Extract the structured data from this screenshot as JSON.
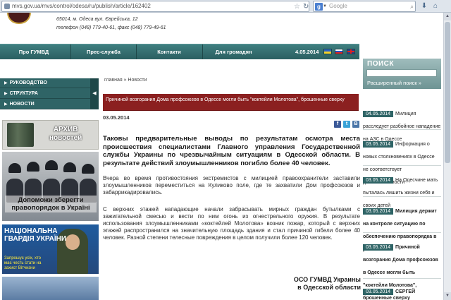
{
  "browser": {
    "url": "mvs.gov.ua/mvs/control/odesa/ru/publish/article/162402",
    "search_placeholder": "Google"
  },
  "header": {
    "address_line1": "65014, м. Одеса вул. Єврейська, 12",
    "address_line2": "телефон (048) 779-40-61, факс (048) 779-49-61"
  },
  "topnav": {
    "items": [
      "Про ГУМВД",
      "Прес-служба",
      "Контакти",
      "Для громадян"
    ],
    "date": "4.05.2014"
  },
  "sidebar": {
    "menu": [
      "РУКОВОДСТВО",
      "СТРУКТУРА",
      "НОВОСТИ"
    ],
    "archive_title_line1": "АРХИВ",
    "archive_title_line2": "новостей",
    "banner1_line1": "Допоможи зберегти",
    "banner1_line2": "правопорядок в Україні",
    "banner2_line1": "НАЦІОНАЛЬНА",
    "banner2_line2": "ГВАРДІЯ УКРАЇНИ",
    "banner2_sub_line1": "Запрошує усіх, хто",
    "banner2_sub_line2": "має честь стати на",
    "banner2_sub_line3": "захист Вітчизни"
  },
  "article": {
    "breadcrumb": "главная » Новости",
    "headline_banner": "Причиной возгорания Дома профсоюзов в Одессе могли быть \"коктейли Молотова\", брошенные сверху",
    "date": "03.05.2014",
    "share_icons": [
      "facebook-icon",
      "twitter-icon",
      "vkontakte-icon"
    ],
    "lead": "Таковы предварительные выводы по результатам осмотра места происшествия специалистами Главного управления Государственной службы Украины по чрезвычайным ситуациям в Одесской области. В результате действий злоумышленников погибло более 40 человек.",
    "paragraph1": "Вчера во время противостояния экстремистов с милицией правоохранители заставили злоумышленников переместиться на Куликово поле, где те захватили Дом профсоюзов и забаррикадировались.",
    "paragraph2": "С верхних этажей нападающие начали забрасывать мирных граждан бутылками с зажигательной смесью и вести по ним огонь из огнестрельного оружия. В результате использования злоумышленниками «коктейлей Молотова» возник пожар, который с верхних этажей распространился на значительную площадь здания и стал причиной гибели более 40 человек. Разной степени телесные повреждения в целом получили более 120 человек.",
    "signature_line1": "ОСО ГУМВД Украины",
    "signature_line2": "в Одесской области"
  },
  "right_sidebar": {
    "search_title": "ПОИСК",
    "advanced_search": "Расширенный поиск »",
    "news": [
      {
        "date": "04.05.2014",
        "text": "Милиция расследует разбойное нападение на АЗС в Одессе",
        "bold": false
      },
      {
        "date": "03.05.2014",
        "text": "Информация о новых столкновениях в Одессе не соответствует действительности",
        "bold": false
      },
      {
        "date": "03.05.2014",
        "text": "На Одесчине мать пыталась лишить жизни себя и своих детей",
        "bold": false
      },
      {
        "date": "03.05.2014",
        "text": "Милиция держит на контроле ситуацию по обеспечению правопорядка в регионе",
        "bold": true
      },
      {
        "date": "03.05.2014",
        "text": "Причиной возгорания Дома профсоюзов в Одессе могли быть \"коктейли Молотова\", брошенные сверху",
        "bold": true
      },
      {
        "date": "03.05.2014",
        "text": "СЕРГЕЙ",
        "bold": true
      }
    ]
  },
  "colors": {
    "nav_teal": "#2f6466",
    "headline_red": "#8b2020"
  }
}
